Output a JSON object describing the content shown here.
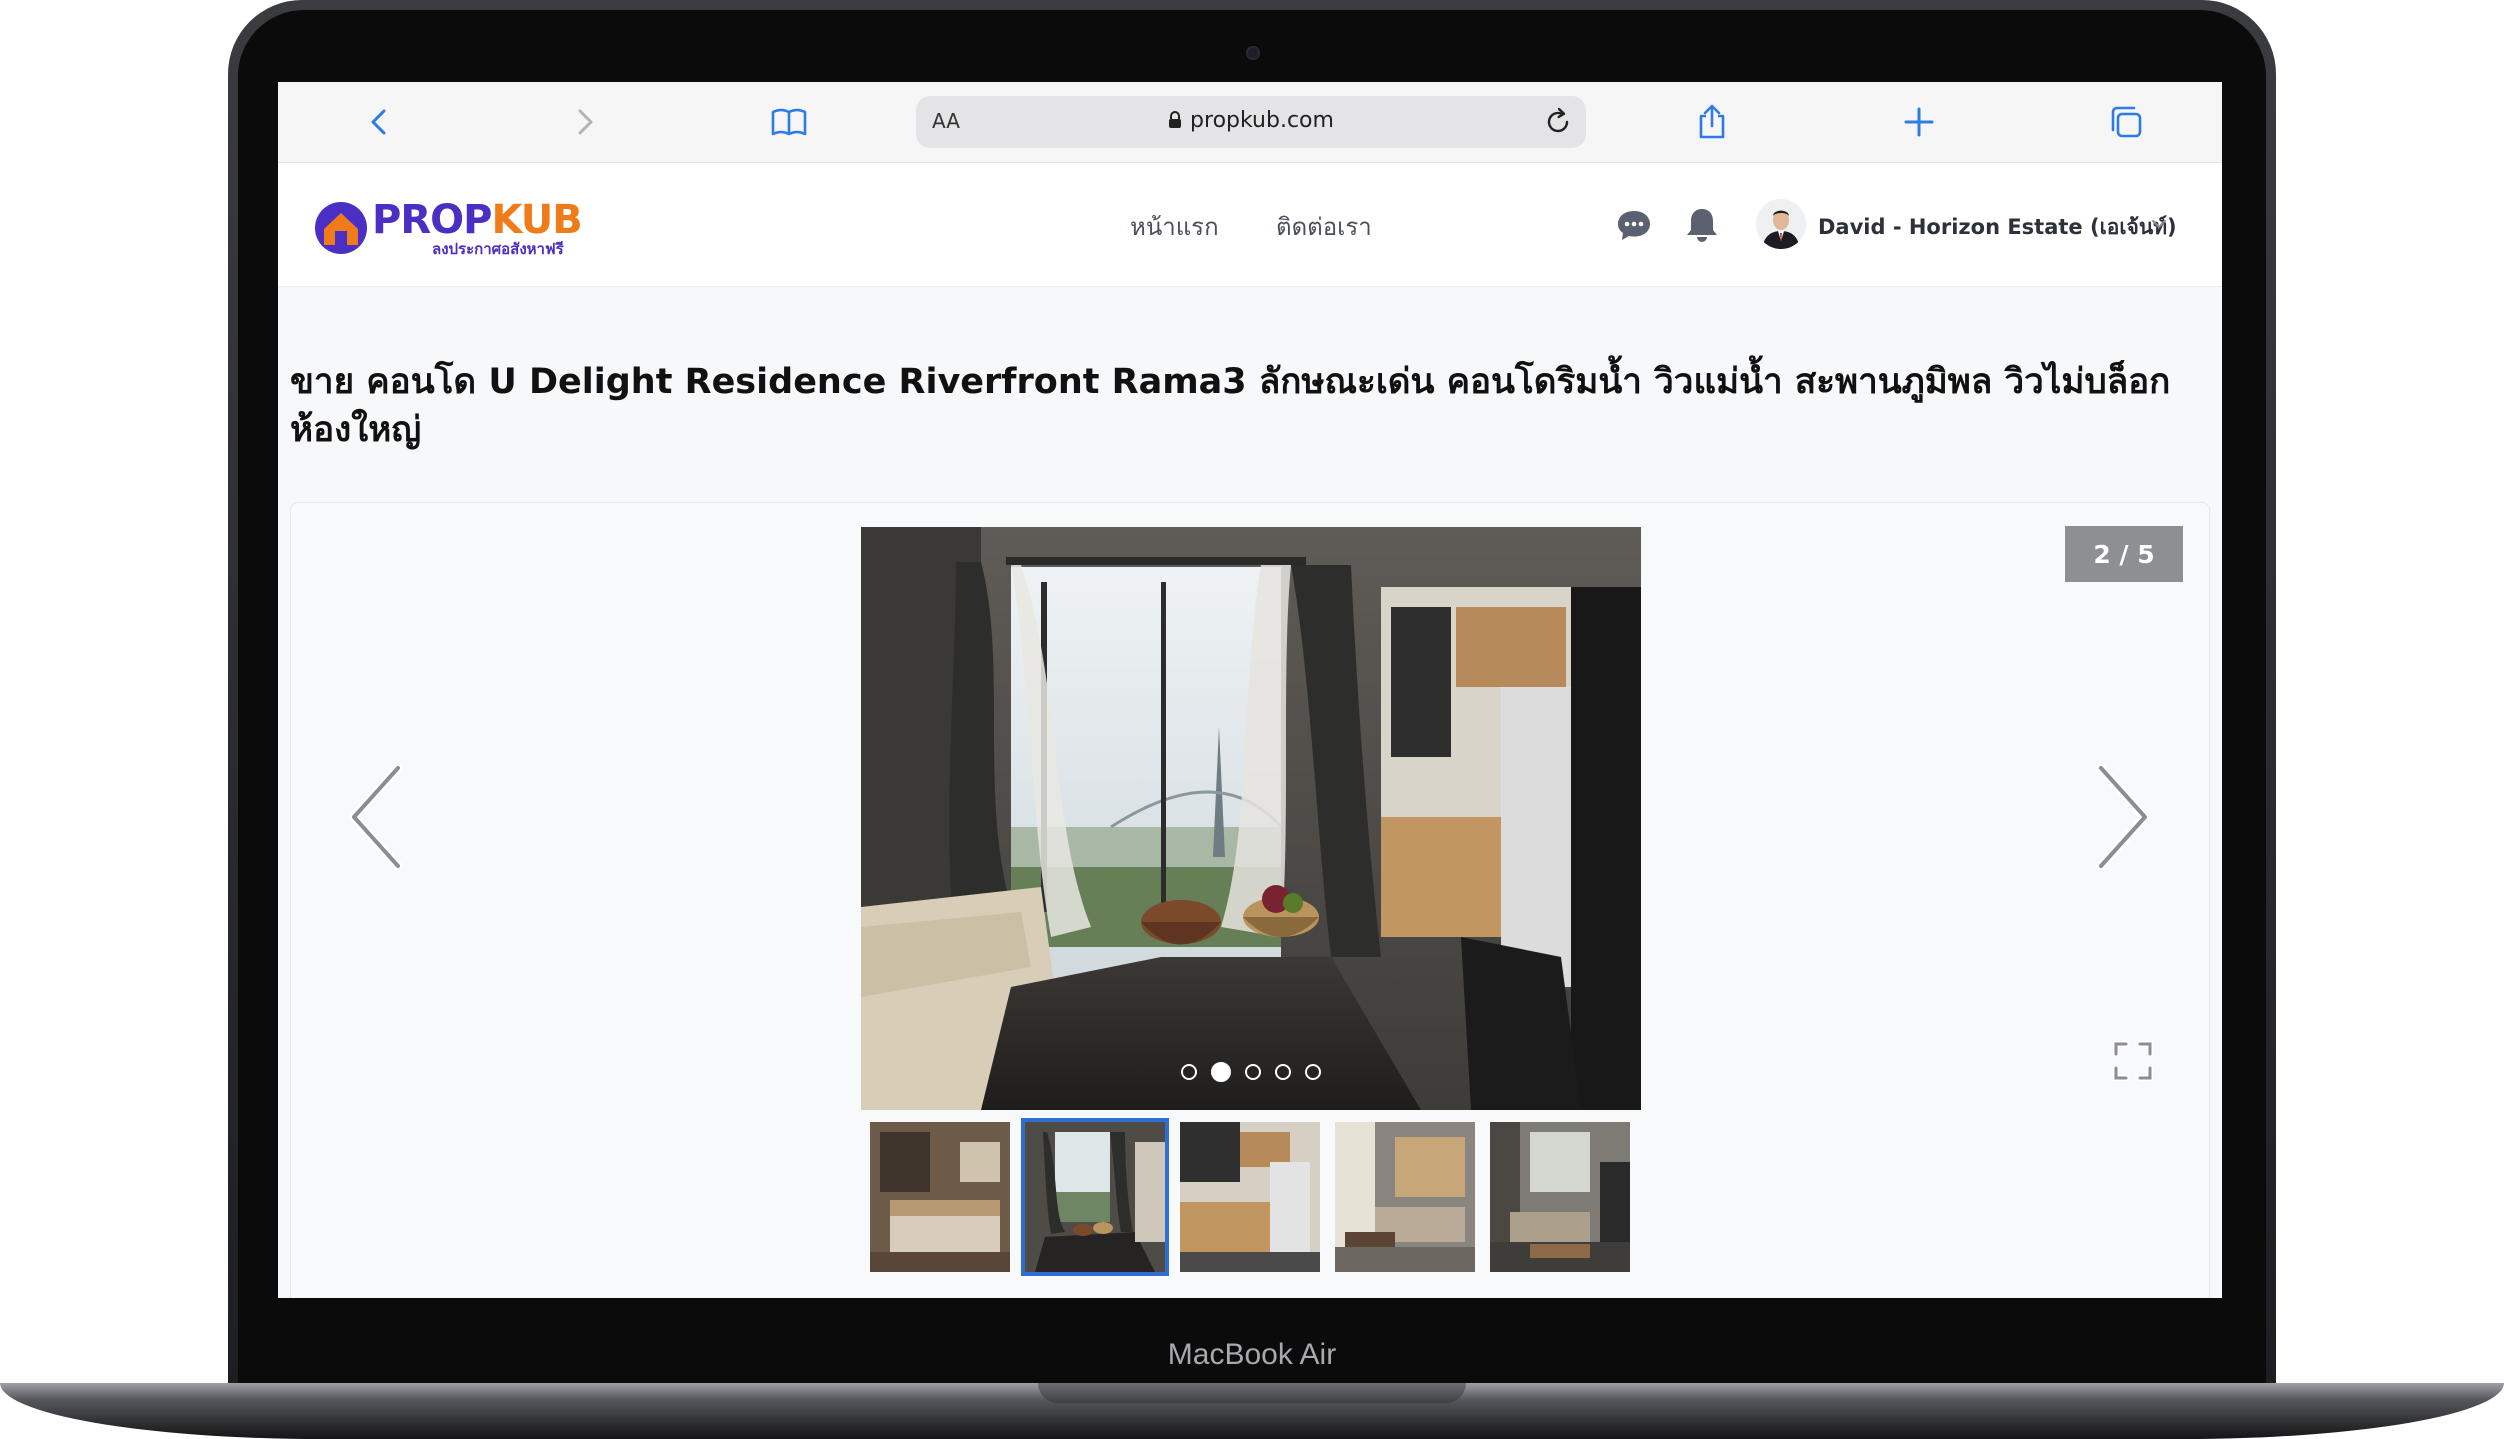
{
  "browser": {
    "url_aa": "AA",
    "url": "propkub.com"
  },
  "site": {
    "logo_prop": "PROP",
    "logo_kub": "KUB",
    "logo_tagline": "ลงประกาศอสังหาฟรี",
    "nav": [
      {
        "label": "หน้าแรก"
      },
      {
        "label": "ติดต่อเรา"
      }
    ],
    "user_name": "David - Horizon Estate (เอเจ้นท์)"
  },
  "listing": {
    "title": "ขาย คอนโด U Delight Residence Riverfront Rama3 ลักษณะเด่น คอนโดริมน้ำ วิวแม่น้ำ สะพานภูมิพล วิวไม่บล็อก ห้องใหญ่"
  },
  "gallery": {
    "counter": "2 / 5",
    "current_index": 2,
    "total": 5
  },
  "device": {
    "model": "MacBook Air"
  },
  "colors": {
    "brand_purple": "#4b2fc4",
    "brand_orange": "#f07b1a",
    "browser_blue": "#2f7be6",
    "thumb_selected": "#2f6fd1"
  }
}
